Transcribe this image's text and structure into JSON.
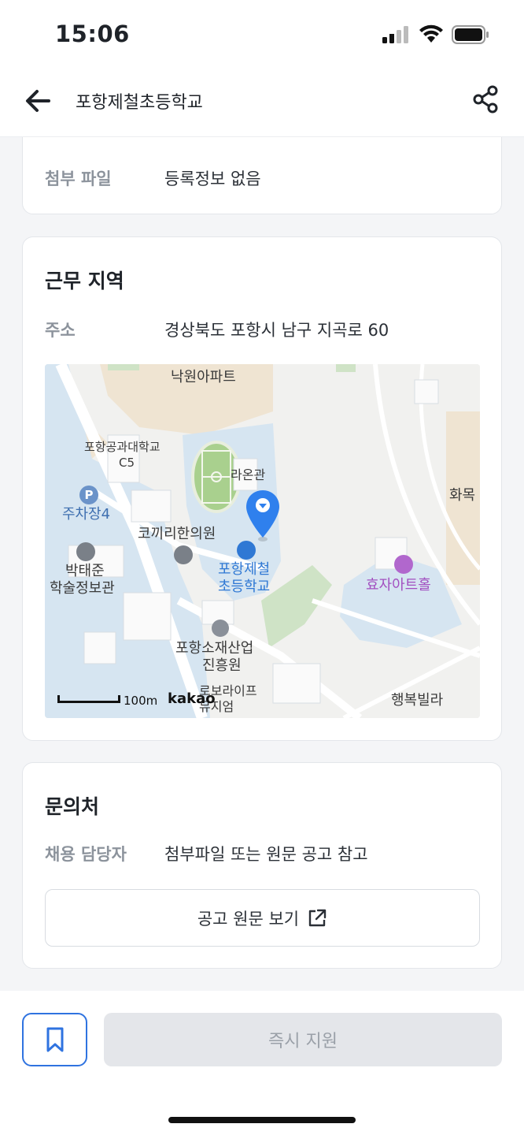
{
  "status_bar": {
    "time": "15:06"
  },
  "header": {
    "title": "포항제철초등학교"
  },
  "attachment": {
    "label": "첨부 파일",
    "value": "등록정보 없음"
  },
  "work_area": {
    "title": "근무 지역",
    "address_label": "주소",
    "address_value": "경상북도 포항시 남구 지곡로 60",
    "map": {
      "labels": {
        "nakwon": "낙원아파트",
        "postech": "포항공과대학교",
        "c5": "C5",
        "parking": "주차장4",
        "raon": "라온관",
        "korean_clinic": "코끼리한의원",
        "library_1": "박태준",
        "library_2": "학술정보관",
        "school_1": "포항제철",
        "school_2": "초등학교",
        "art_hall": "효자아트홀",
        "hwamok": "화목",
        "institute_1": "포항소재산업",
        "institute_2": "진흥원",
        "robo_1": "로보라이프",
        "robo_2": "뮤지엄",
        "happy_villa": "행복빌라",
        "scale": "100m",
        "brand": "kakao"
      }
    }
  },
  "contact": {
    "title": "문의처",
    "manager_label": "채용 담당자",
    "manager_value": "첨부파일 또는 원문 공고 참고",
    "original_button": "공고 원문 보기"
  },
  "bottom_bar": {
    "apply_label": "즉시 지원"
  },
  "colors": {
    "accent": "#2f73e0",
    "disabled_bg": "#e4e6ea",
    "pin": "#2f80ed"
  }
}
